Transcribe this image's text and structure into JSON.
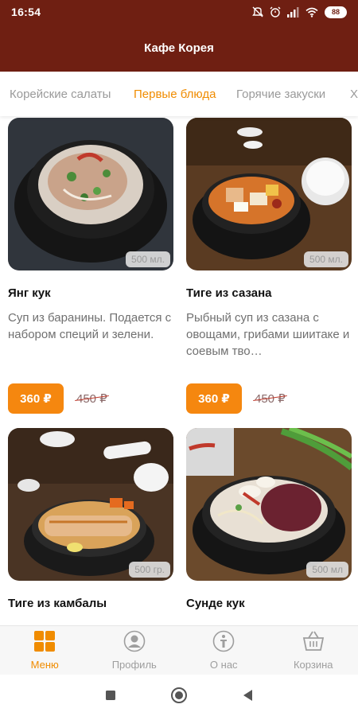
{
  "status_bar": {
    "time": "16:54",
    "battery": "88"
  },
  "app_bar": {
    "title": "Кафе Корея"
  },
  "tabs": [
    {
      "label": "Корейские салаты",
      "active": false
    },
    {
      "label": "Первые блюда",
      "active": true
    },
    {
      "label": "Горячие закуски",
      "active": false
    },
    {
      "label": "Хо",
      "active": false
    }
  ],
  "products": [
    {
      "name": "Янг кук",
      "description": "Суп из баранины. Подается с набором специй и зелени.",
      "portion": "500 мл.",
      "price": "360 ₽",
      "old_price": "450 ₽"
    },
    {
      "name": "Тиге из сазана",
      "description": "Рыбный суп из сазана с овощами, грибами шиитаке и соевым тво…",
      "portion": "500 мл.",
      "price": "360 ₽",
      "old_price": "450 ₽"
    },
    {
      "name": "Тиге из камбалы",
      "description": "",
      "portion": "500 гр.",
      "price": "",
      "old_price": ""
    },
    {
      "name": "Сунде кук",
      "description": "",
      "portion": "500 мл",
      "price": "",
      "old_price": ""
    }
  ],
  "bottom_nav": [
    {
      "label": "Меню",
      "icon": "menu-grid-icon",
      "active": true
    },
    {
      "label": "Профиль",
      "icon": "profile-icon",
      "active": false
    },
    {
      "label": "О нас",
      "icon": "about-icon",
      "active": false
    },
    {
      "label": "Корзина",
      "icon": "cart-icon",
      "active": false
    }
  ],
  "colors": {
    "brand": "#6f1f12",
    "accent": "#f5870f",
    "tab_active": "#f08c00"
  }
}
